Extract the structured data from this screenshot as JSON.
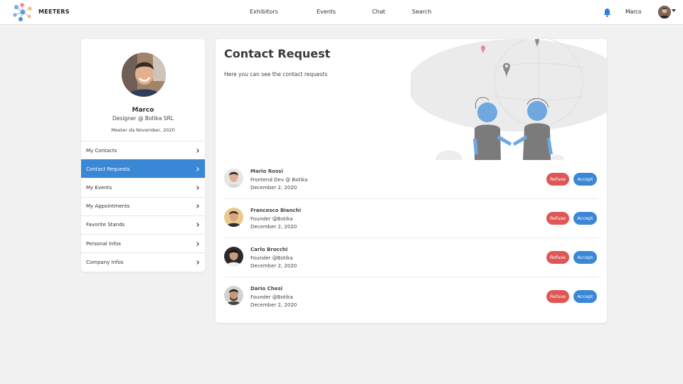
{
  "brand": {
    "name": "MEETERS",
    "logo_icon": "network-dots-icon"
  },
  "nav": {
    "links": [
      "Exhibitors",
      "Events",
      "Chat",
      "Search"
    ],
    "user_name": "Marco",
    "notification_icon": "bell-icon",
    "accent": "#2f7fd9"
  },
  "profile": {
    "name": "Marco",
    "role": "Designer @ Botika SRL",
    "since": "Meeter da November, 2020"
  },
  "menu": {
    "items": [
      {
        "label": "My Contacts",
        "active": false
      },
      {
        "label": "Contact Requests",
        "active": true
      },
      {
        "label": "My Events",
        "active": false
      },
      {
        "label": "My Appointments",
        "active": false
      },
      {
        "label": "Favorite Stands",
        "active": false
      },
      {
        "label": "Personal Infos",
        "active": false
      },
      {
        "label": "Company Infos",
        "active": false
      }
    ],
    "active_color": "#3a87d6"
  },
  "main": {
    "title": "Contact Request",
    "subtitle": "Here you can see the contact requests",
    "refuse_label": "Refuse",
    "accept_label": "Accept",
    "refuse_color": "#e05656",
    "accept_color": "#3a87d6",
    "contacts": [
      {
        "name": "Mario Rossi",
        "role": "Frontend Dev @ Botika",
        "date": "December 2, 2020"
      },
      {
        "name": "Francesco Bianchi",
        "role": "Founder @Botika",
        "date": "December 2, 2020"
      },
      {
        "name": "Carlo Brocchi",
        "role": "Founder @Botika",
        "date": "December 2, 2020"
      },
      {
        "name": "Dario Chesi",
        "role": "Founder @Botika",
        "date": "December 2, 2020"
      }
    ]
  }
}
